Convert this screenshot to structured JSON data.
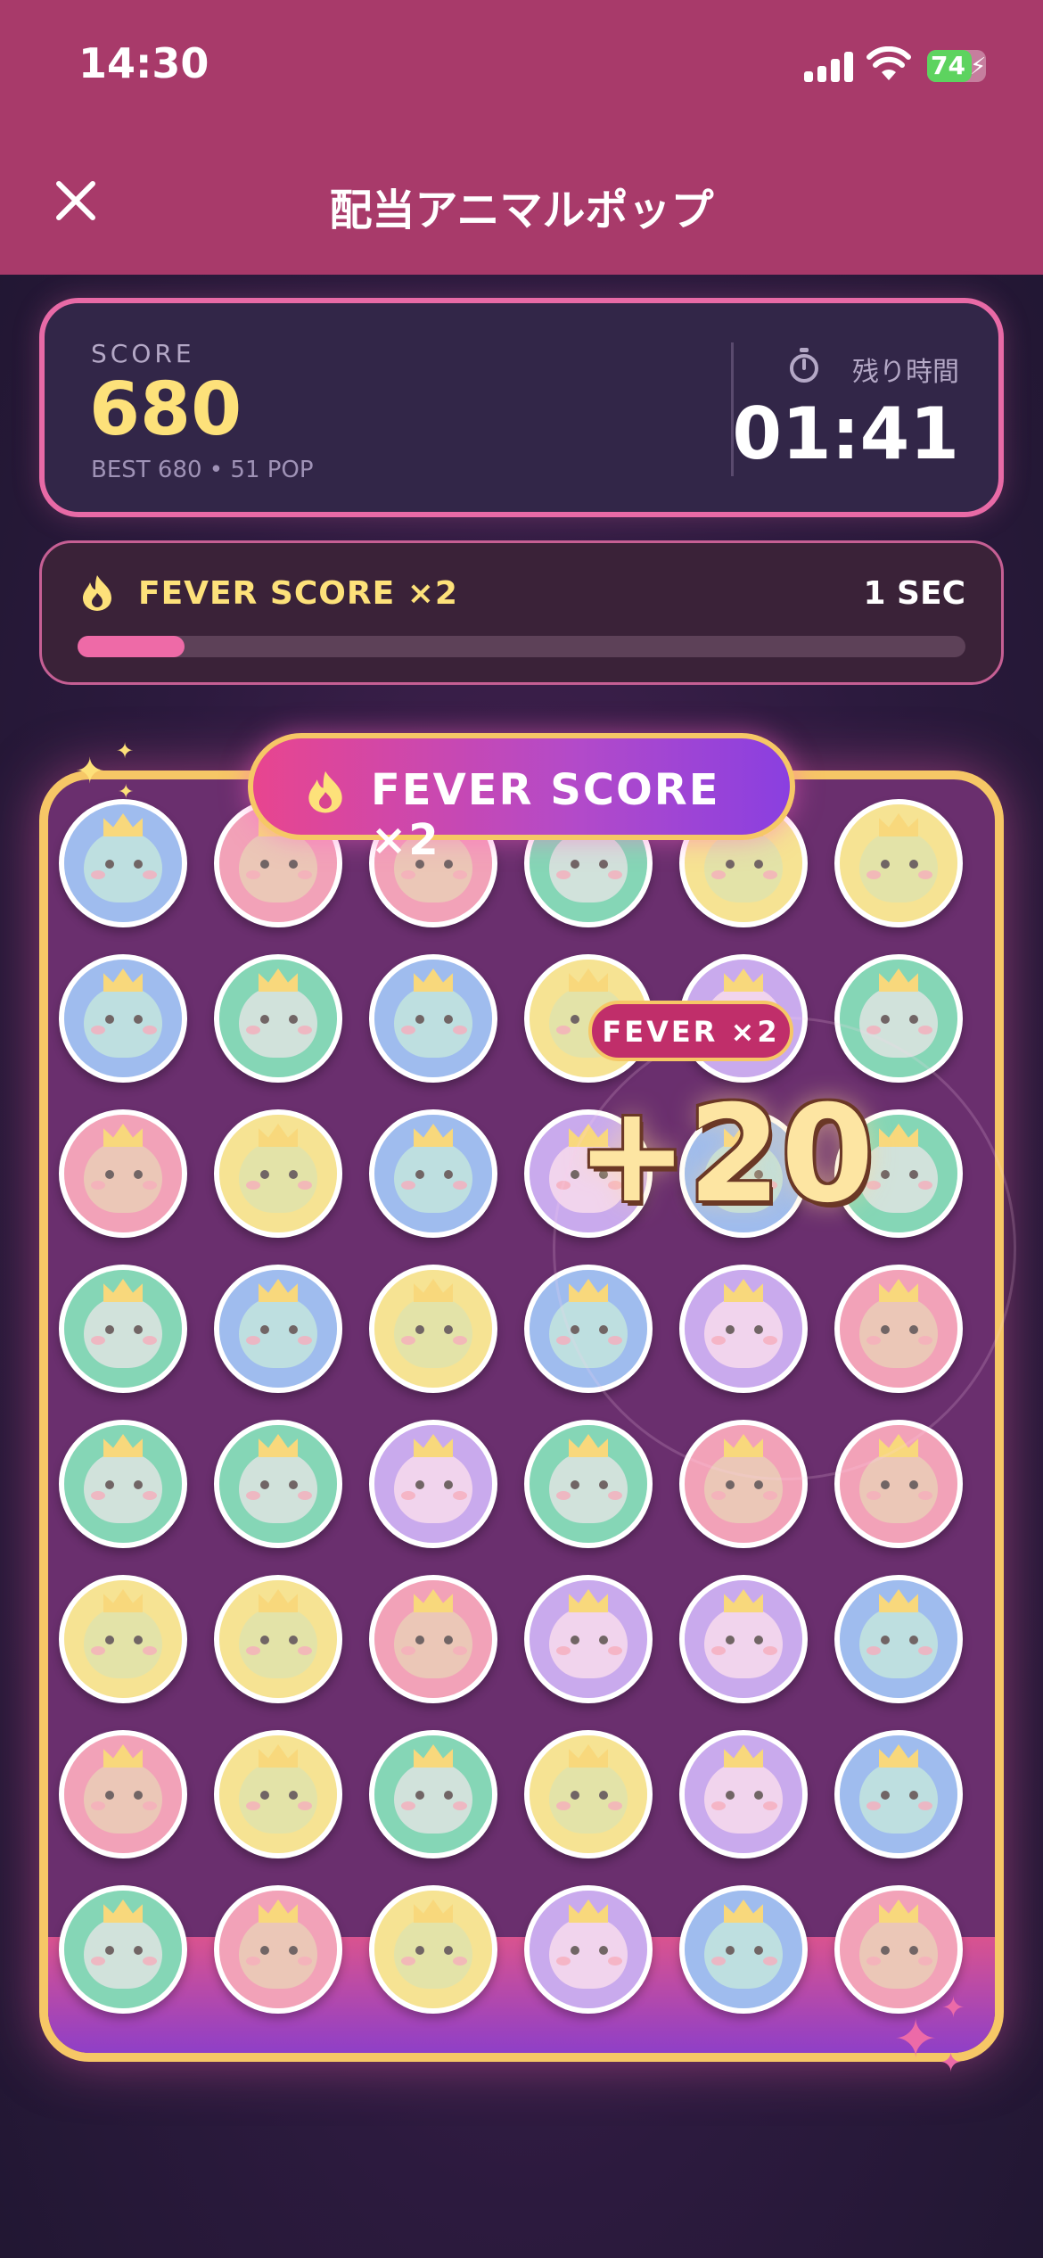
{
  "status_bar": {
    "time": "14:30",
    "battery": "74"
  },
  "header": {
    "title": "配当アニマルポップ"
  },
  "score_card": {
    "label": "SCORE",
    "value": "680",
    "meta": "BEST 680  •  51 POP",
    "timer_label": "残り時間",
    "timer_value": "01:41"
  },
  "fever_card": {
    "label": "FEVER  SCORE ×2",
    "remaining": "1 SEC",
    "progress": 0.12
  },
  "banner": {
    "text": "FEVER  SCORE ×2"
  },
  "pop_effect": {
    "chip": "FEVER ×2",
    "points": "+20"
  },
  "board": {
    "rows": [
      [
        "squirrel",
        "shiba",
        "shiba",
        "elephant",
        "capybara",
        "capybara"
      ],
      [
        "squirrel",
        "elephant",
        "squirrel",
        "capybara",
        "lion",
        "elephant"
      ],
      [
        "shiba",
        "capybara",
        "squirrel",
        "lion",
        "squirrel",
        "elephant"
      ],
      [
        "elephant",
        "squirrel",
        "capybara",
        "squirrel",
        "lion",
        "shiba"
      ],
      [
        "elephant",
        "elephant",
        "lion",
        "elephant",
        "shiba",
        "shiba"
      ],
      [
        "capybara",
        "capybara",
        "shiba",
        "lion",
        "lion",
        "squirrel"
      ],
      [
        "shiba",
        "capybara",
        "elephant",
        "capybara",
        "lion",
        "squirrel"
      ],
      [
        "elephant",
        "shiba",
        "capybara",
        "lion",
        "squirrel",
        "shiba"
      ]
    ]
  },
  "colors": {
    "header": "#a83a6a",
    "accent_gold": "#fde17a",
    "board_border": "#f6c766",
    "squirrel": "#7aa3e8",
    "shiba": "#ee7f9d",
    "elephant": "#57c79a",
    "capybara": "#f3d86a",
    "lion": "#b489e6"
  }
}
